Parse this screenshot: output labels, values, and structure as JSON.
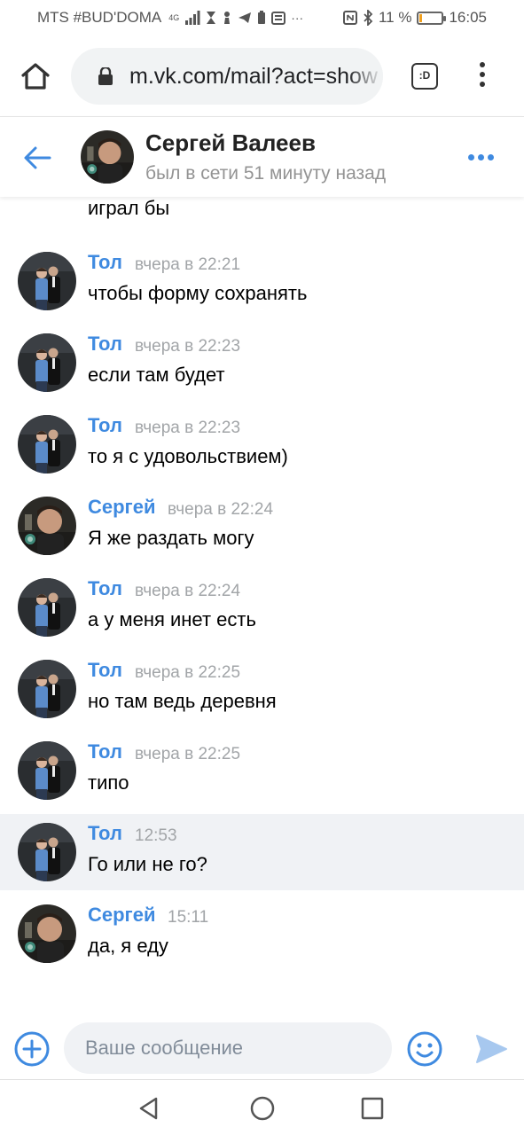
{
  "status_bar": {
    "carrier": "MTS #BUD'DOMA",
    "network": "4G",
    "battery": "11 %",
    "battery_level": 0.11,
    "time": "16:05"
  },
  "browser": {
    "url": "m.vk.com/mail?act=show",
    "tabs_label": ":D"
  },
  "chat": {
    "name": "Сергей Валеев",
    "status": "был в сети 51 минуту назад"
  },
  "colors": {
    "accent": "#3f8ae0",
    "time_grey": "#a2a5a8",
    "highlight_bg": "#f0f2f5"
  },
  "messages": {
    "continued_text": "играл бы",
    "items": [
      {
        "author": "Тол",
        "time": "вчера в 22:21",
        "text": "чтобы форму сохранять",
        "avatar": "tol"
      },
      {
        "author": "Тол",
        "time": "вчера в 22:23",
        "text": "если там будет",
        "avatar": "tol"
      },
      {
        "author": "Тол",
        "time": "вчера в 22:23",
        "text": "то я с удовольствием)",
        "avatar": "tol"
      },
      {
        "author": "Сергей",
        "time": "вчера в 22:24",
        "text": "Я же раздать могу",
        "avatar": "sergey"
      },
      {
        "author": "Тол",
        "time": "вчера в 22:24",
        "text": "а у меня инет есть",
        "avatar": "tol"
      },
      {
        "author": "Тол",
        "time": "вчера в 22:25",
        "text": "но там ведь деревня",
        "avatar": "tol"
      },
      {
        "author": "Тол",
        "time": "вчера в 22:25",
        "text": "типо",
        "avatar": "tol"
      },
      {
        "author": "Тол",
        "time": "12:53",
        "text": "Го или не го?",
        "avatar": "tol",
        "highlighted": true
      },
      {
        "author": "Сергей",
        "time": "15:11",
        "text": "да, я еду",
        "avatar": "sergey"
      }
    ]
  },
  "composer": {
    "placeholder": "Ваше сообщение"
  }
}
